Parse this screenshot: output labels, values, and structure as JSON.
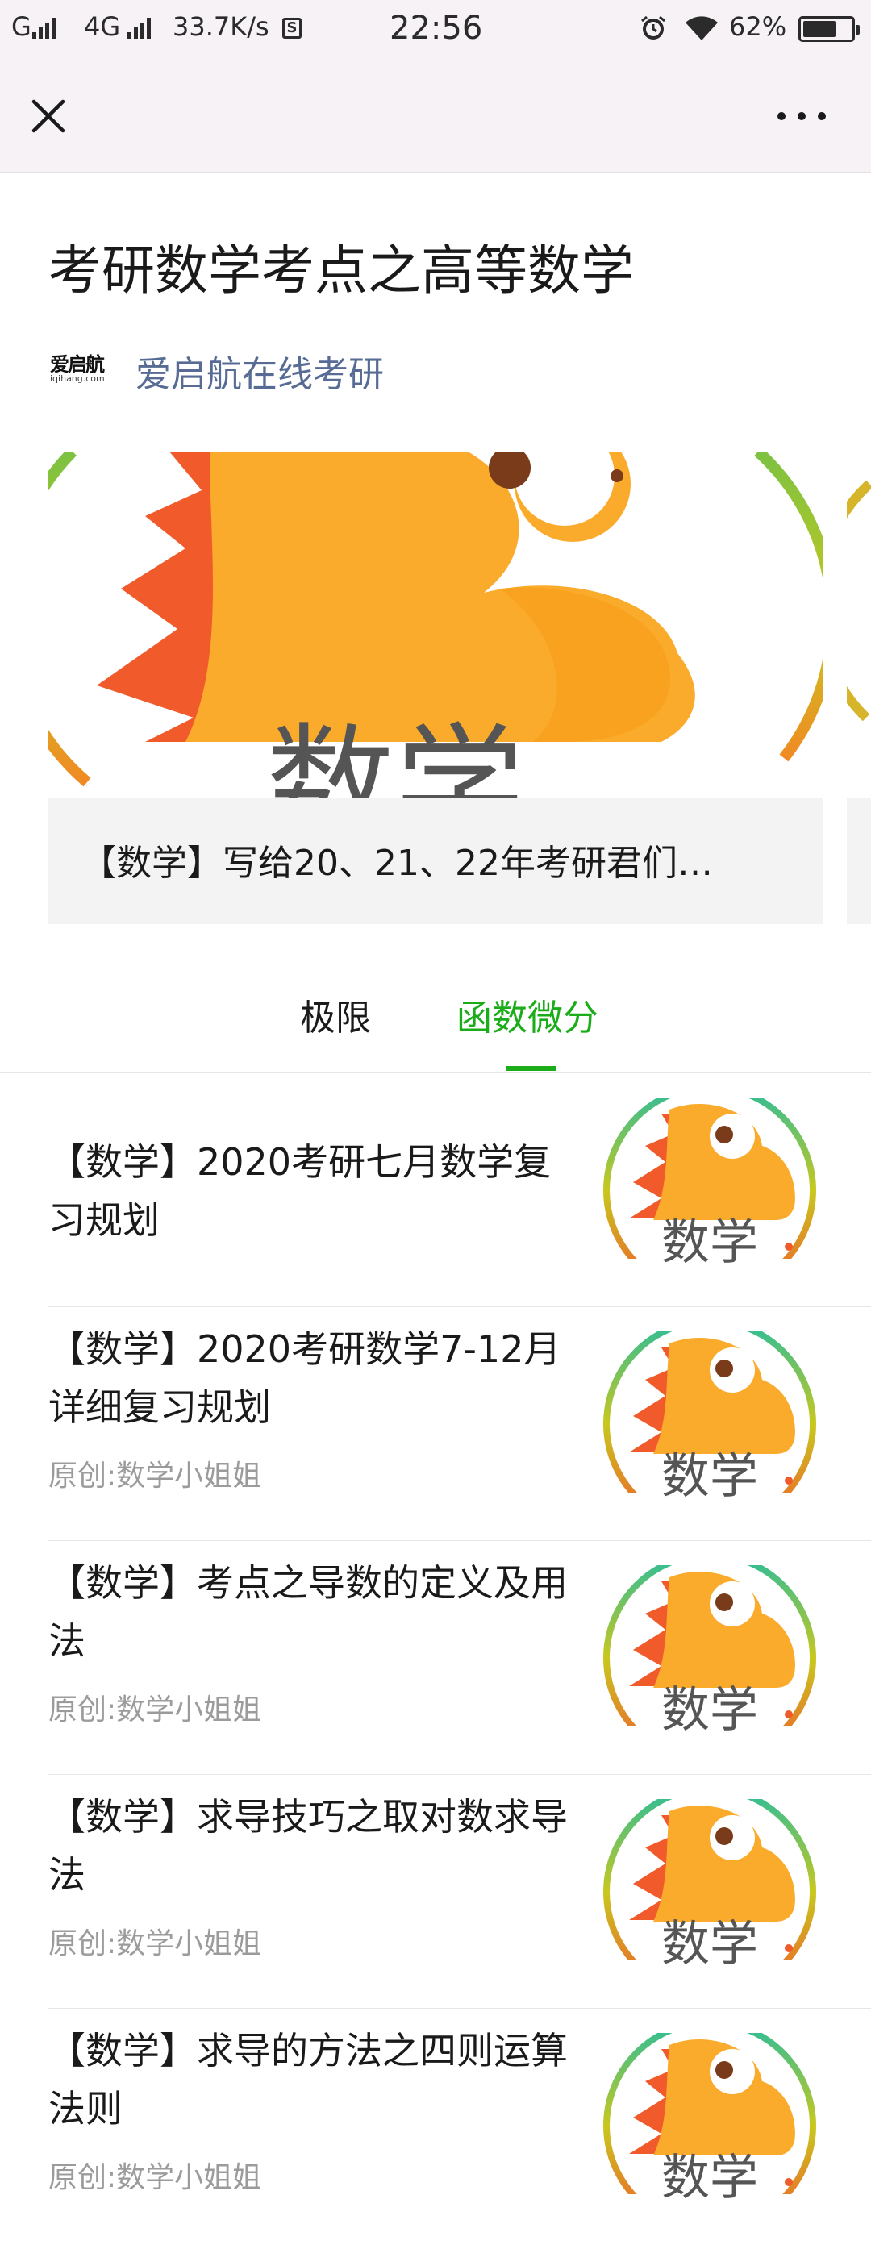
{
  "status_bar": {
    "carrier": "G",
    "network": "4G",
    "speed": "33.7K/s",
    "speed_icon_letter": "S",
    "time": "22:56",
    "battery": "62%",
    "battery_level": 0.62
  },
  "nav": {
    "close_icon": "close-icon",
    "more_icon": "more-icon"
  },
  "header": {
    "title": "考研数学考点之高等数学",
    "account_logo_text": "爱启航",
    "account_logo_sub": "iqihang.com",
    "account_name": "爱启航在线考研"
  },
  "carousel": {
    "image_text": "数学",
    "caption": "【数学】写给20、21、22年考研君们…"
  },
  "tabs": [
    {
      "label": "极限",
      "active": false
    },
    {
      "label": "函数微分",
      "active": true
    }
  ],
  "colors": {
    "accent": "#1aad19",
    "link": "#576b95",
    "mascot_orange": "#fbab2b",
    "mascot_red": "#f15a2b"
  },
  "articles": [
    {
      "title": "【数学】2020考研七月数学复习规划",
      "source": "",
      "thumb_text": "数学"
    },
    {
      "title": "【数学】2020考研数学7-12月详细复习规划",
      "source": "原创:数学小姐姐",
      "thumb_text": "数学"
    },
    {
      "title": "【数学】考点之导数的定义及用法",
      "source": "原创:数学小姐姐",
      "thumb_text": "数学"
    },
    {
      "title": "【数学】求导技巧之取对数求导法",
      "source": "原创:数学小姐姐",
      "thumb_text": "数学"
    },
    {
      "title": "【数学】求导的方法之四则运算法则",
      "source": "原创:数学小姐姐",
      "thumb_text": "数学"
    }
  ]
}
